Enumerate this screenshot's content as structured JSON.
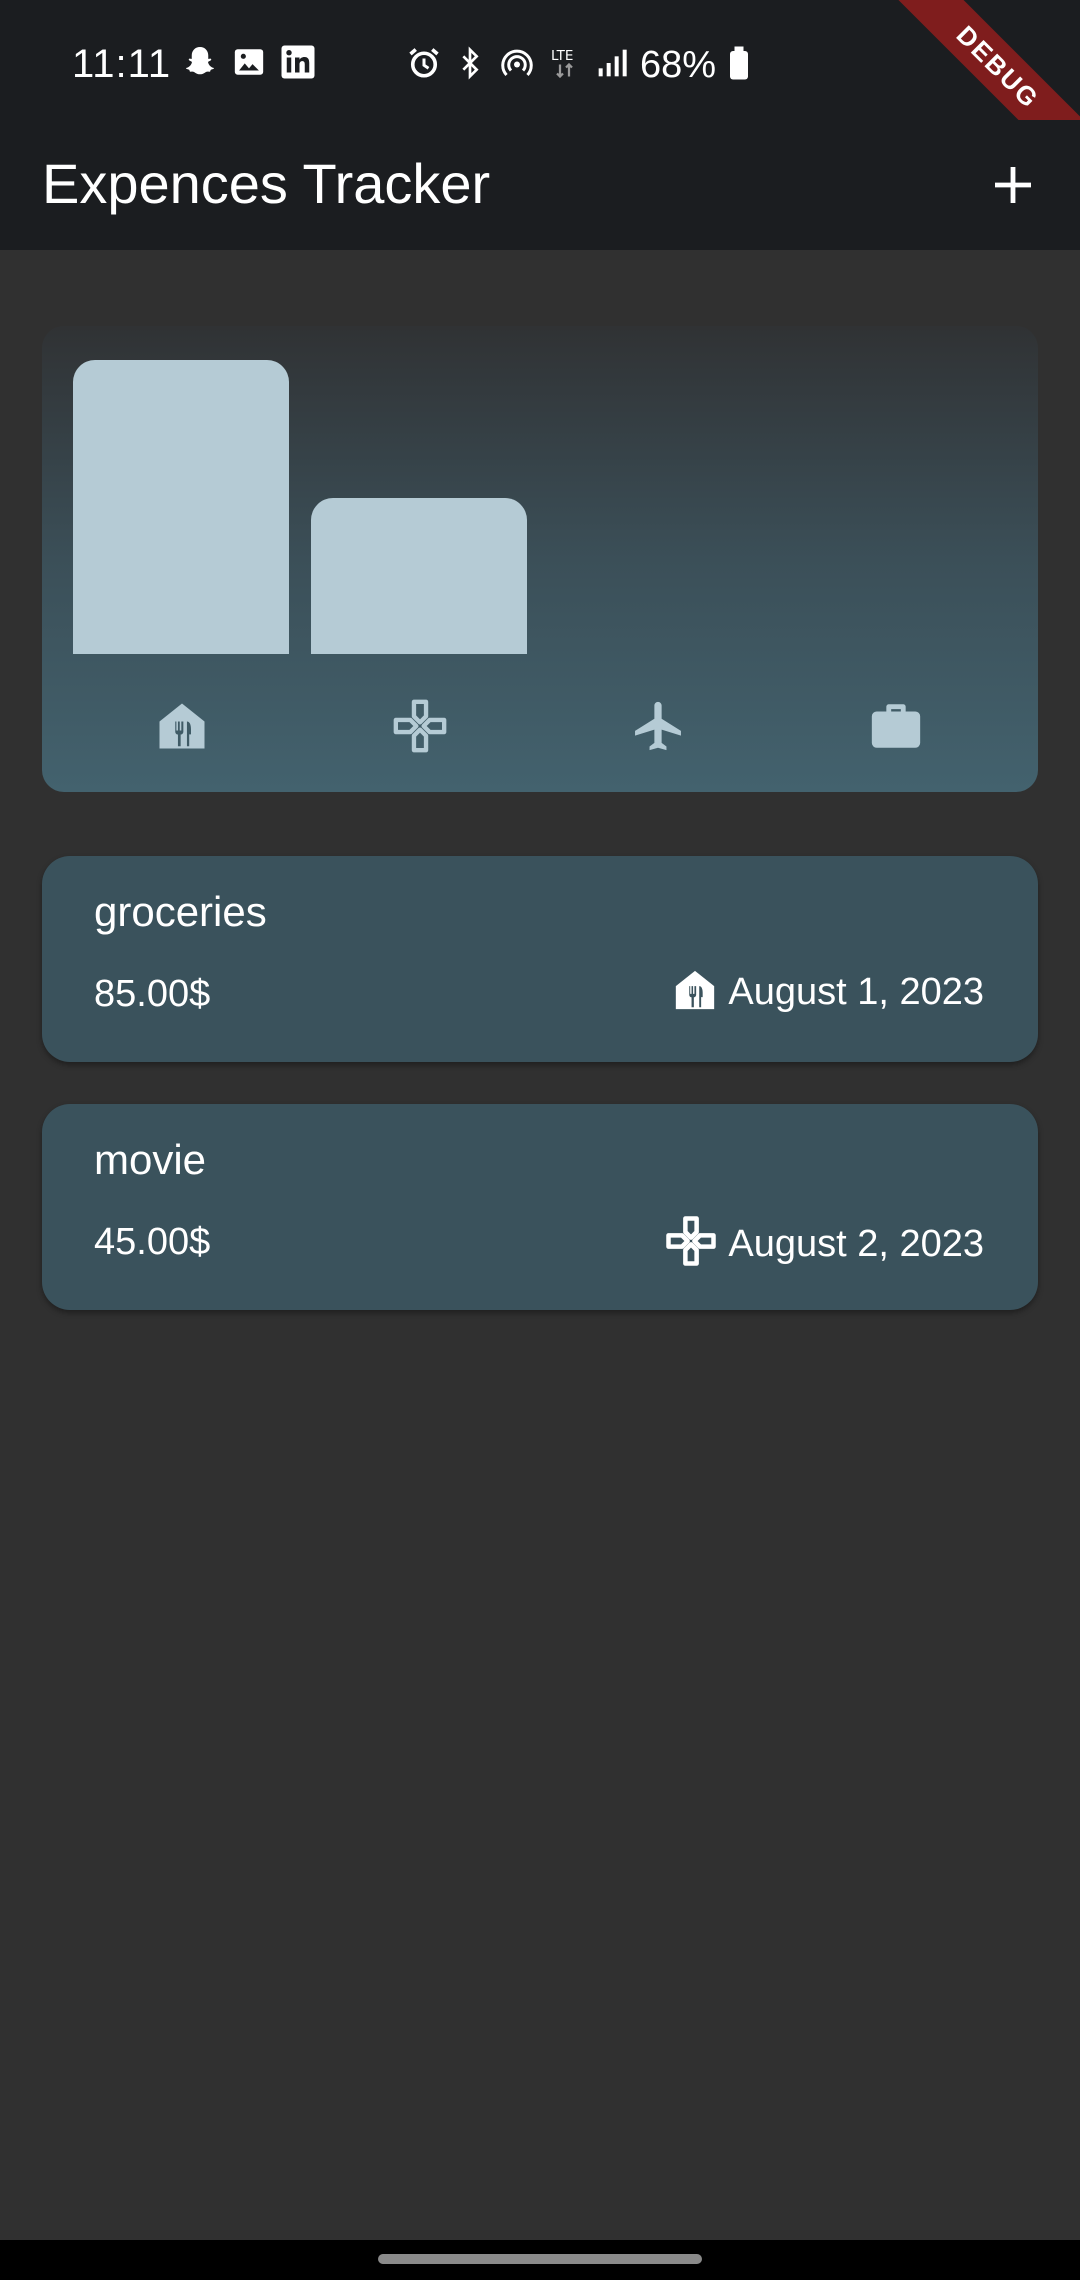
{
  "status_bar": {
    "time": "11:11",
    "battery": "68%",
    "left_icons": [
      "snapchat-icon",
      "gallery-icon",
      "linkedin-icon"
    ],
    "right_icons": [
      "alarm-icon",
      "bluetooth-icon",
      "hotspot-icon",
      "lte-icon",
      "signal-icon",
      "battery-icon"
    ]
  },
  "debug_banner": "DEBUG",
  "app_bar": {
    "title": "Expences Tracker",
    "add_icon": "plus-icon"
  },
  "chart": {
    "categories": [
      "food",
      "leisure",
      "travel",
      "work"
    ],
    "category_icons": [
      "food-store-icon",
      "gamepad-icon",
      "airplane-icon",
      "briefcase-icon"
    ],
    "values": [
      85,
      45,
      0,
      0
    ],
    "bar_color": "#b5cbd5"
  },
  "expenses": [
    {
      "title": "groceries",
      "amount": "85.00$",
      "date": "August 1, 2023",
      "category_icon": "food-store-icon"
    },
    {
      "title": "movie",
      "amount": "45.00$",
      "date": "August 2, 2023",
      "category_icon": "gamepad-icon"
    }
  ],
  "colors": {
    "background": "#303030",
    "app_bar": "#1b1d20",
    "card": "#3a525c",
    "icon_chart": "#b5cbd5"
  }
}
